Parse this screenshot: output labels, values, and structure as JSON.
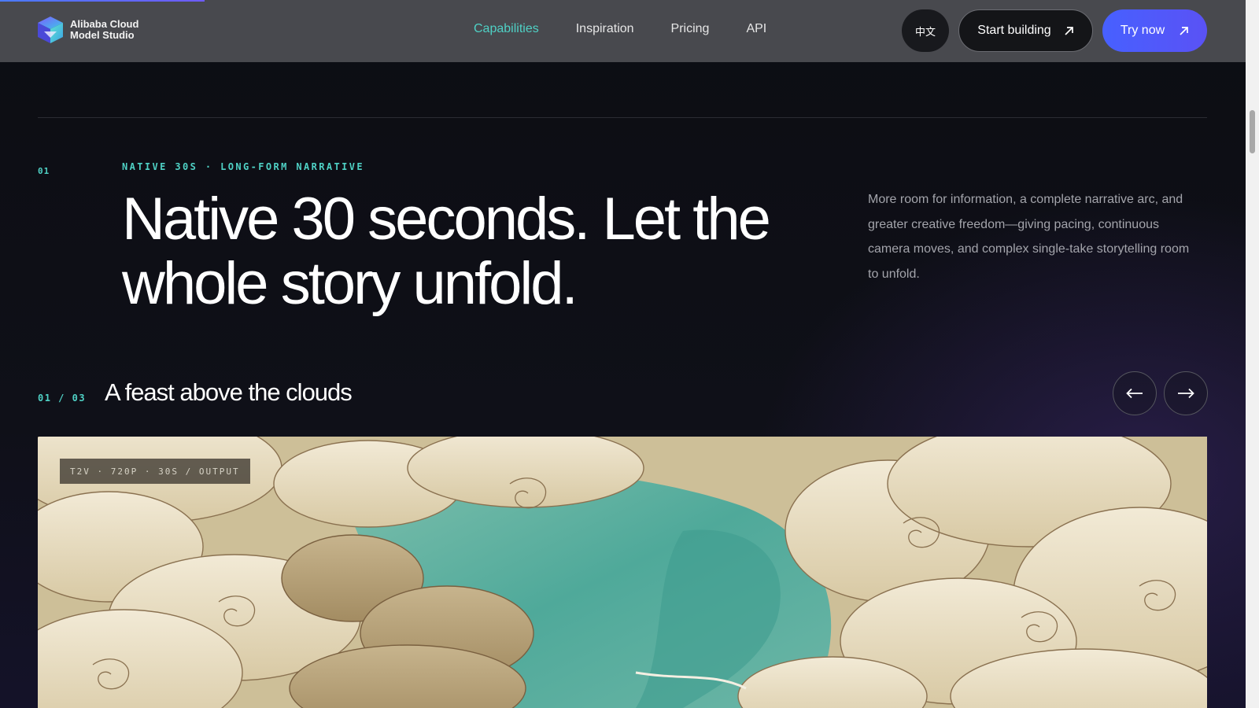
{
  "header": {
    "logo": {
      "line1": "Alibaba Cloud",
      "line2": "Model Studio",
      "icon": "model-studio-logo-icon"
    },
    "nav": [
      {
        "label": "Capabilities",
        "active": true
      },
      {
        "label": "Inspiration",
        "active": false
      },
      {
        "label": "Pricing",
        "active": false
      },
      {
        "label": "API",
        "active": false
      }
    ],
    "lang_label": "中文",
    "start_label": "Start building",
    "try_label": "Try now",
    "colors": {
      "accent": "#4fd1c5",
      "try_bg": "#4760ff",
      "header_bg": "#48494e"
    }
  },
  "section": {
    "number": "01",
    "eyebrow": "NATIVE 30S · LONG-FORM NARRATIVE",
    "headline": "Native 30 seconds. Let the whole story unfold.",
    "description": "More room for information, a complete narrative arc, and greater creative freedom—giving pacing, continuous camera moves, and complex single-take storytelling room to unfold."
  },
  "carousel": {
    "counter": "01 / 03",
    "title": "A feast above the clouds",
    "prev_icon": "arrow-left-icon",
    "next_icon": "arrow-right-icon",
    "media_tag": "T2V · 720P · 30S / OUTPUT"
  }
}
